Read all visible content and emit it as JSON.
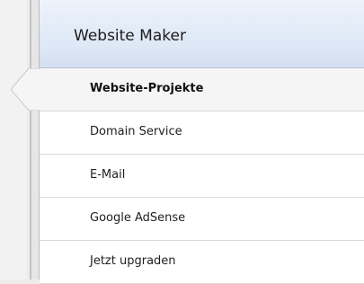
{
  "header": {
    "title": "Website Maker"
  },
  "menu": {
    "items": [
      {
        "label": "Website-Projekte",
        "active": true
      },
      {
        "label": "Domain Service",
        "active": false
      },
      {
        "label": "E-Mail",
        "active": false
      },
      {
        "label": "Google AdSense",
        "active": false
      },
      {
        "label": "Jetzt upgraden",
        "active": false
      }
    ]
  }
}
